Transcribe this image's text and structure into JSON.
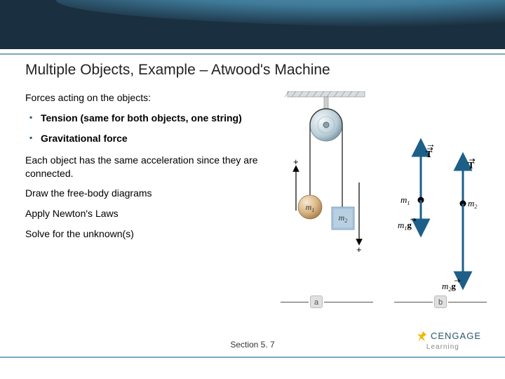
{
  "header": {
    "brand": "CENGAGE",
    "sub": "Learning"
  },
  "title": "Multiple Objects, Example – Atwood's Machine",
  "content": {
    "lead": "Forces acting on the objects:",
    "bullets": [
      "Tension (same for both objects, one string)",
      "Gravitational force"
    ],
    "para1": "Each object has the same acceleration since they are connected.",
    "steps": [
      "Draw the free-body diagrams",
      "Apply Newton's Laws",
      "Solve for the unknown(s)"
    ]
  },
  "figure": {
    "labels": {
      "a": "a",
      "b": "b"
    },
    "masses": {
      "m1": "m",
      "m2": "m"
    },
    "vectors": {
      "T": "T",
      "g1": "g",
      "g2": "g"
    }
  },
  "footer": {
    "section": "Section 5. 7"
  }
}
